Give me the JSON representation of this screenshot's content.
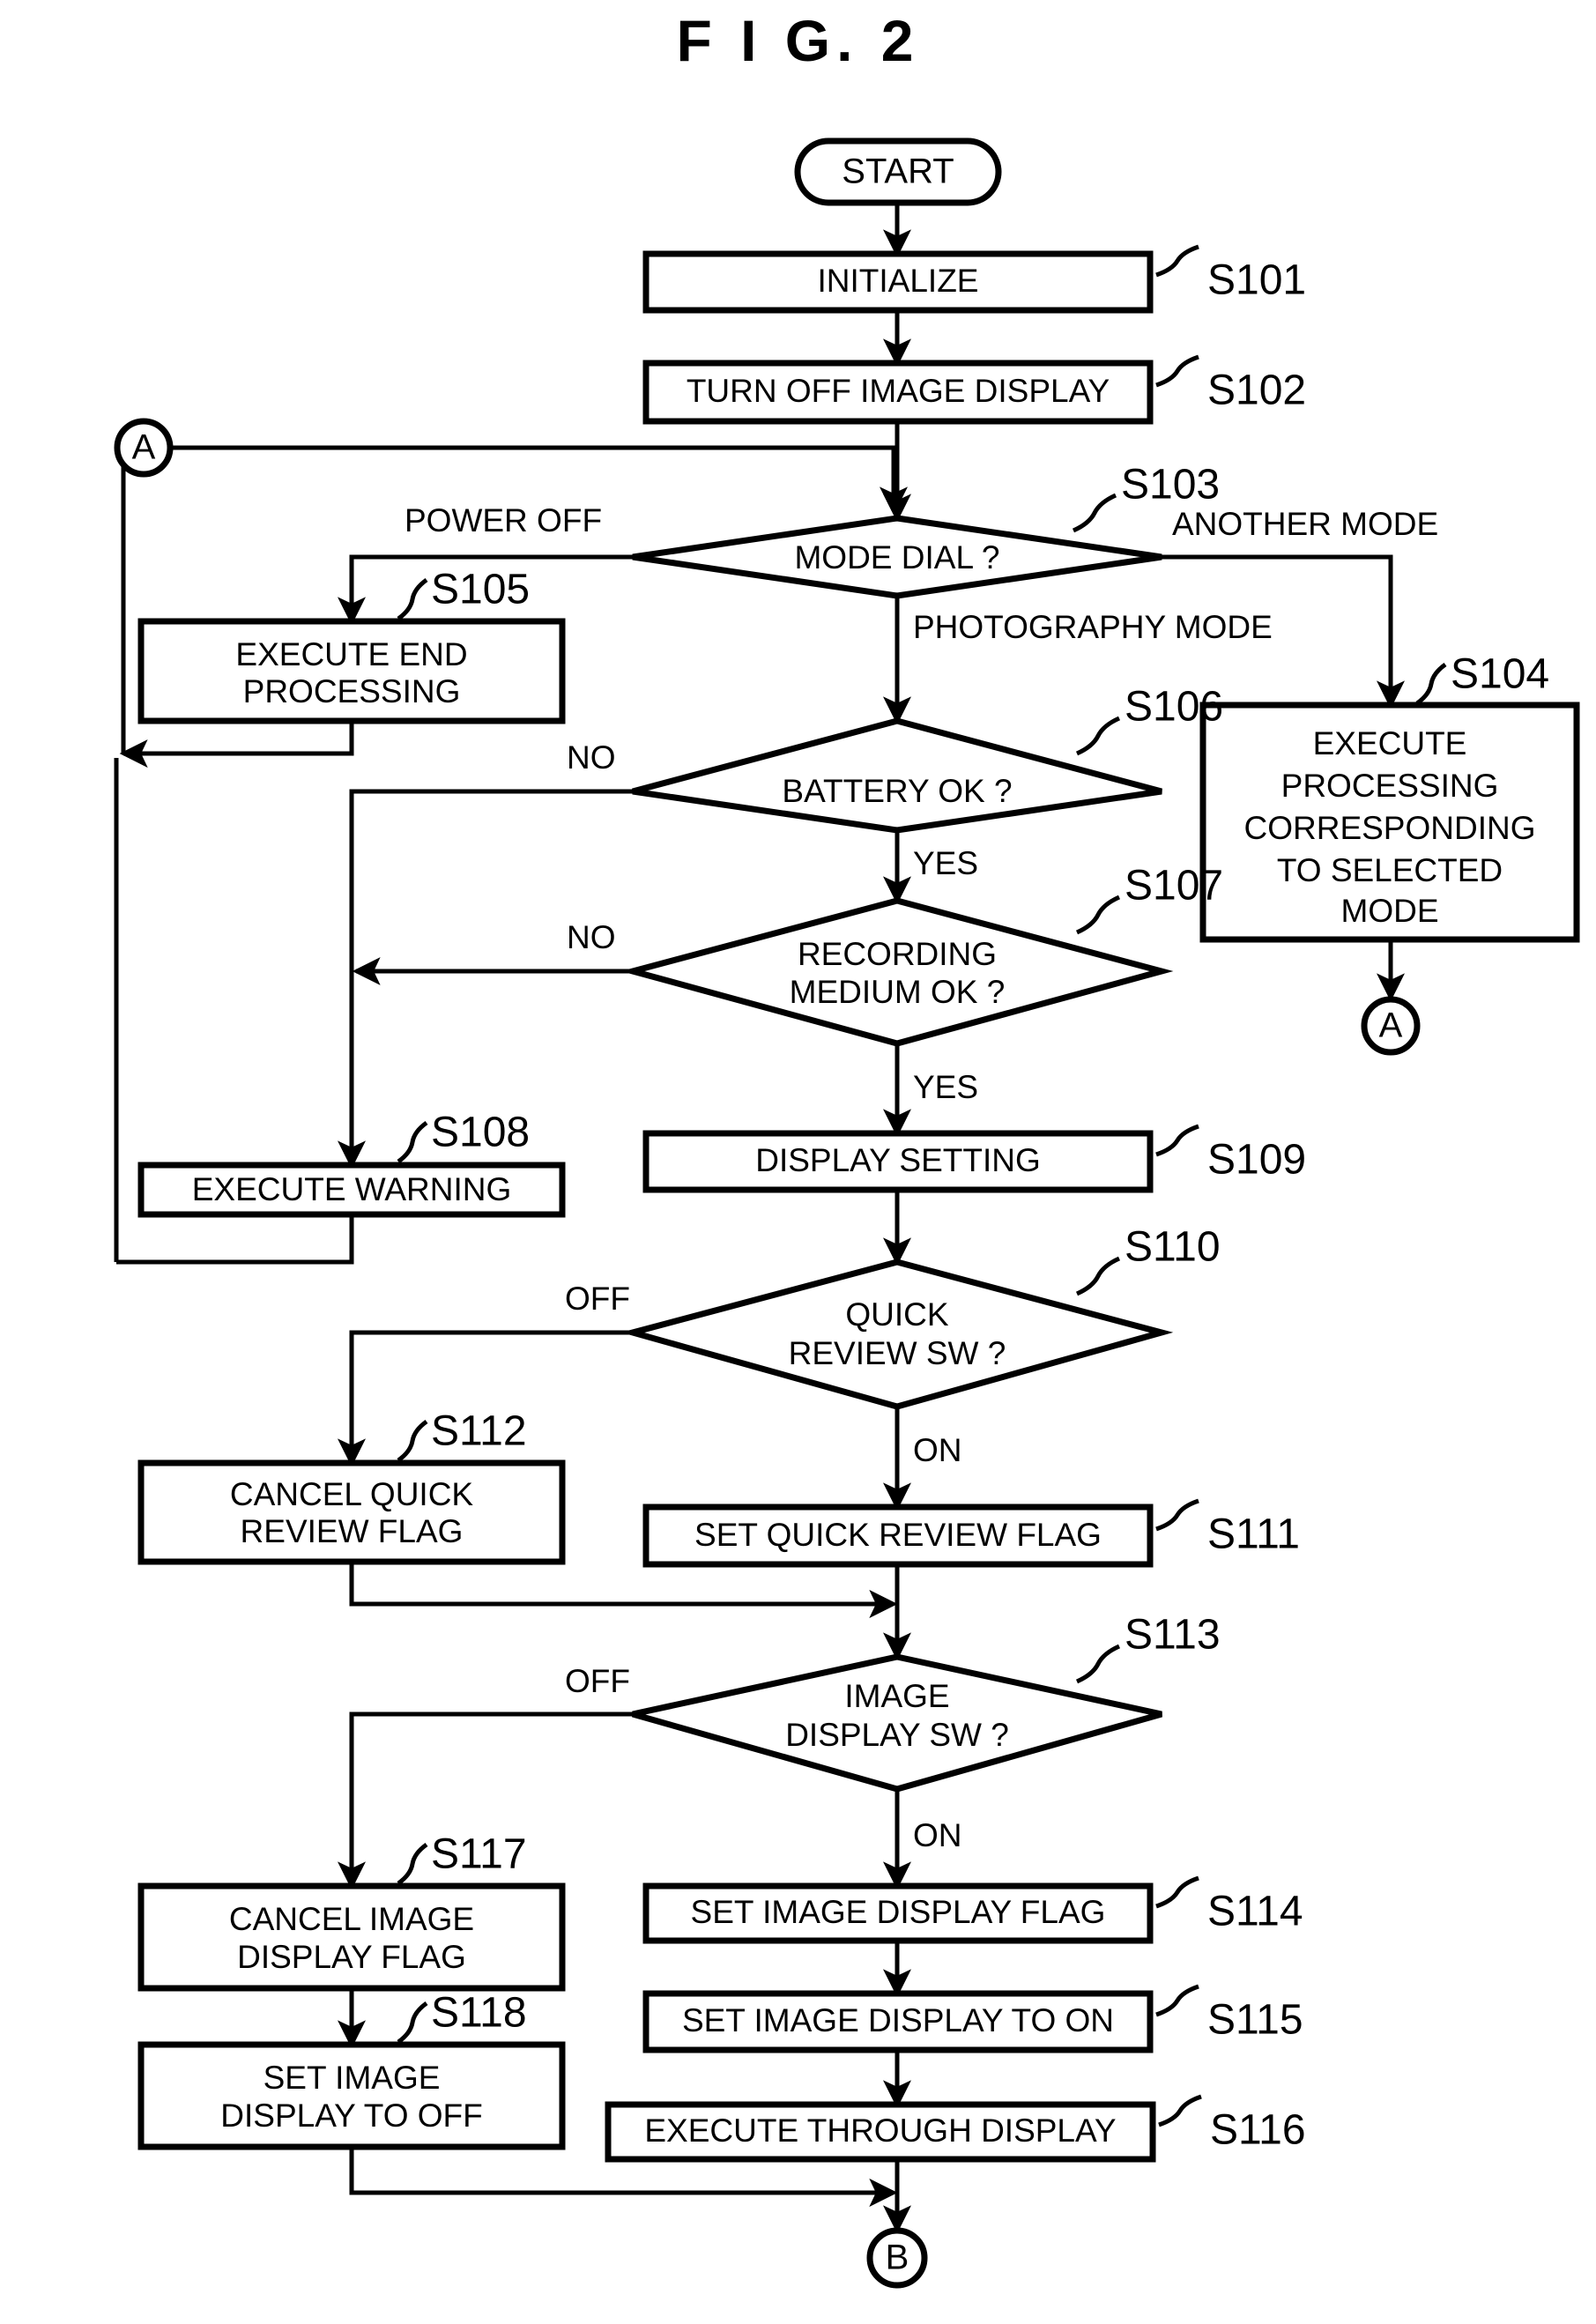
{
  "figure": {
    "title": "F I G.  2"
  },
  "terminals": {
    "start": "START",
    "connector_a_left": "A",
    "connector_a_right": "A",
    "connector_b": "B"
  },
  "nodes": [
    {
      "id": "S101",
      "step": "S101",
      "type": "process",
      "text": [
        "INITIALIZE"
      ]
    },
    {
      "id": "S102",
      "step": "S102",
      "type": "process",
      "text": [
        "TURN OFF IMAGE DISPLAY"
      ]
    },
    {
      "id": "S103",
      "step": "S103",
      "type": "decision",
      "text": [
        "MODE DIAL ?"
      ]
    },
    {
      "id": "S104",
      "step": "S104",
      "type": "process",
      "text": [
        "EXECUTE",
        "PROCESSING",
        "CORRESPONDING",
        "TO SELECTED",
        "MODE"
      ]
    },
    {
      "id": "S105",
      "step": "S105",
      "type": "process",
      "text": [
        "EXECUTE END",
        "PROCESSING"
      ]
    },
    {
      "id": "S106",
      "step": "S106",
      "type": "decision",
      "text": [
        "BATTERY OK ?"
      ]
    },
    {
      "id": "S107",
      "step": "S107",
      "type": "decision",
      "text": [
        "RECORDING",
        "MEDIUM OK ?"
      ]
    },
    {
      "id": "S108",
      "step": "S108",
      "type": "process",
      "text": [
        "EXECUTE WARNING"
      ]
    },
    {
      "id": "S109",
      "step": "S109",
      "type": "process",
      "text": [
        "DISPLAY SETTING"
      ]
    },
    {
      "id": "S110",
      "step": "S110",
      "type": "decision",
      "text": [
        "QUICK",
        "REVIEW SW ?"
      ]
    },
    {
      "id": "S111",
      "step": "S111",
      "type": "process",
      "text": [
        "SET QUICK REVIEW FLAG"
      ]
    },
    {
      "id": "S112",
      "step": "S112",
      "type": "process",
      "text": [
        "CANCEL QUICK",
        "REVIEW FLAG"
      ]
    },
    {
      "id": "S113",
      "step": "S113",
      "type": "decision",
      "text": [
        "IMAGE",
        "DISPLAY SW ?"
      ]
    },
    {
      "id": "S114",
      "step": "S114",
      "type": "process",
      "text": [
        "SET IMAGE DISPLAY FLAG"
      ]
    },
    {
      "id": "S115",
      "step": "S115",
      "type": "process",
      "text": [
        "SET IMAGE DISPLAY TO ON"
      ]
    },
    {
      "id": "S116",
      "step": "S116",
      "type": "process",
      "text": [
        "EXECUTE THROUGH DISPLAY"
      ]
    },
    {
      "id": "S117",
      "step": "S117",
      "type": "process",
      "text": [
        "CANCEL IMAGE",
        "DISPLAY FLAG"
      ]
    },
    {
      "id": "S118",
      "step": "S118",
      "type": "process",
      "text": [
        "SET IMAGE",
        "DISPLAY TO OFF"
      ]
    }
  ],
  "edge_labels": {
    "power_off": "POWER OFF",
    "another_mode": "ANOTHER MODE",
    "photography_mode": "PHOTOGRAPHY MODE",
    "battery_no": "NO",
    "battery_yes": "YES",
    "medium_no": "NO",
    "medium_yes": "YES",
    "quick_off": "OFF",
    "quick_on": "ON",
    "imgdisp_off": "OFF",
    "imgdisp_on": "ON"
  },
  "colors": {
    "ink": "#000000",
    "paper": "#ffffff"
  }
}
